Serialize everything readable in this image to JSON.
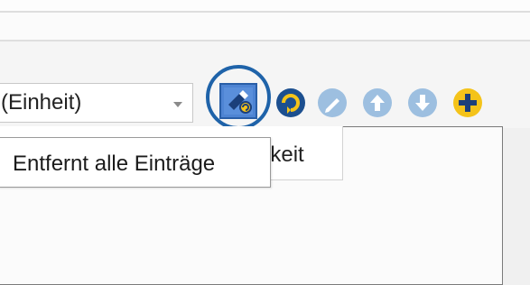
{
  "unit_combo": {
    "value": "(Einheit)",
    "arrow_icon": "chevron-down-icon"
  },
  "toolbar": {
    "buttons": [
      {
        "icon": "clear-entries-icon",
        "state": "highlighted"
      },
      {
        "icon": "refresh-icon",
        "state": "enabled"
      },
      {
        "icon": "edit-pencil-icon",
        "state": "disabled"
      },
      {
        "icon": "move-up-icon",
        "state": "disabled"
      },
      {
        "icon": "move-down-icon",
        "state": "disabled"
      },
      {
        "icon": "add-icon",
        "state": "enabled"
      }
    ]
  },
  "tooltip": {
    "text": "Entfernt alle Einträge"
  },
  "grid": {
    "column_header_visible_text": "gkeit"
  },
  "colors": {
    "highlight_ring": "#1f63a9",
    "active_blue": "#1c4f8f",
    "disabled_blue": "#9dbfe0",
    "add_yellow": "#f4c31a"
  }
}
